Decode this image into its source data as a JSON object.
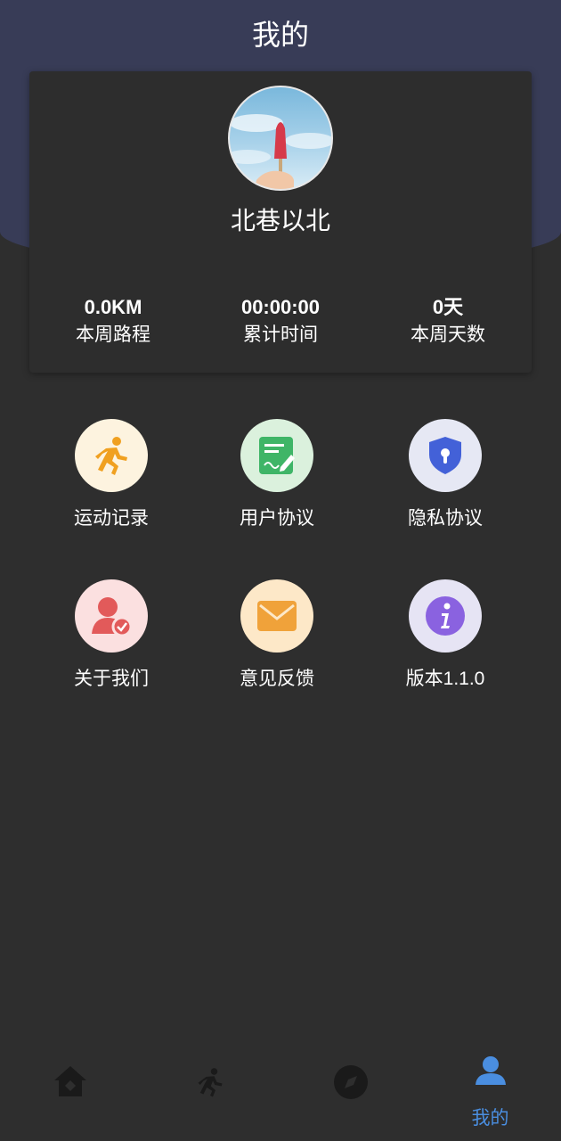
{
  "header": {
    "title": "我的"
  },
  "profile": {
    "username": "北巷以北",
    "stats": [
      {
        "value": "0.0KM",
        "label": "本周路程"
      },
      {
        "value": "00:00:00",
        "label": "累计时间"
      },
      {
        "value": "0天",
        "label": "本周天数"
      }
    ]
  },
  "menu": [
    {
      "label": "运动记录",
      "icon": "running-icon",
      "bg": "#fdf3df",
      "color": "#f0a020"
    },
    {
      "label": "用户协议",
      "icon": "agreement-document-icon",
      "bg": "#dbf1dd",
      "color": "#3fb567"
    },
    {
      "label": "隐私协议",
      "icon": "privacy-shield-icon",
      "bg": "#e6e8f4",
      "color": "#4361d8"
    },
    {
      "label": "关于我们",
      "icon": "about-user-icon",
      "bg": "#fbe0e0",
      "color": "#e25a5a"
    },
    {
      "label": "意见反馈",
      "icon": "feedback-mail-icon",
      "bg": "#fde8c8",
      "color": "#f0a23a"
    },
    {
      "label": "版本1.1.0",
      "icon": "info-icon",
      "bg": "#e6e4f4",
      "color": "#8a62e0"
    }
  ],
  "tabbar": {
    "tabs": [
      {
        "icon": "home-icon",
        "label": ""
      },
      {
        "icon": "run-icon",
        "label": ""
      },
      {
        "icon": "compass-icon",
        "label": ""
      },
      {
        "icon": "profile-icon",
        "label": "我的",
        "active": true
      }
    ],
    "active_color": "#4a8ee0"
  }
}
